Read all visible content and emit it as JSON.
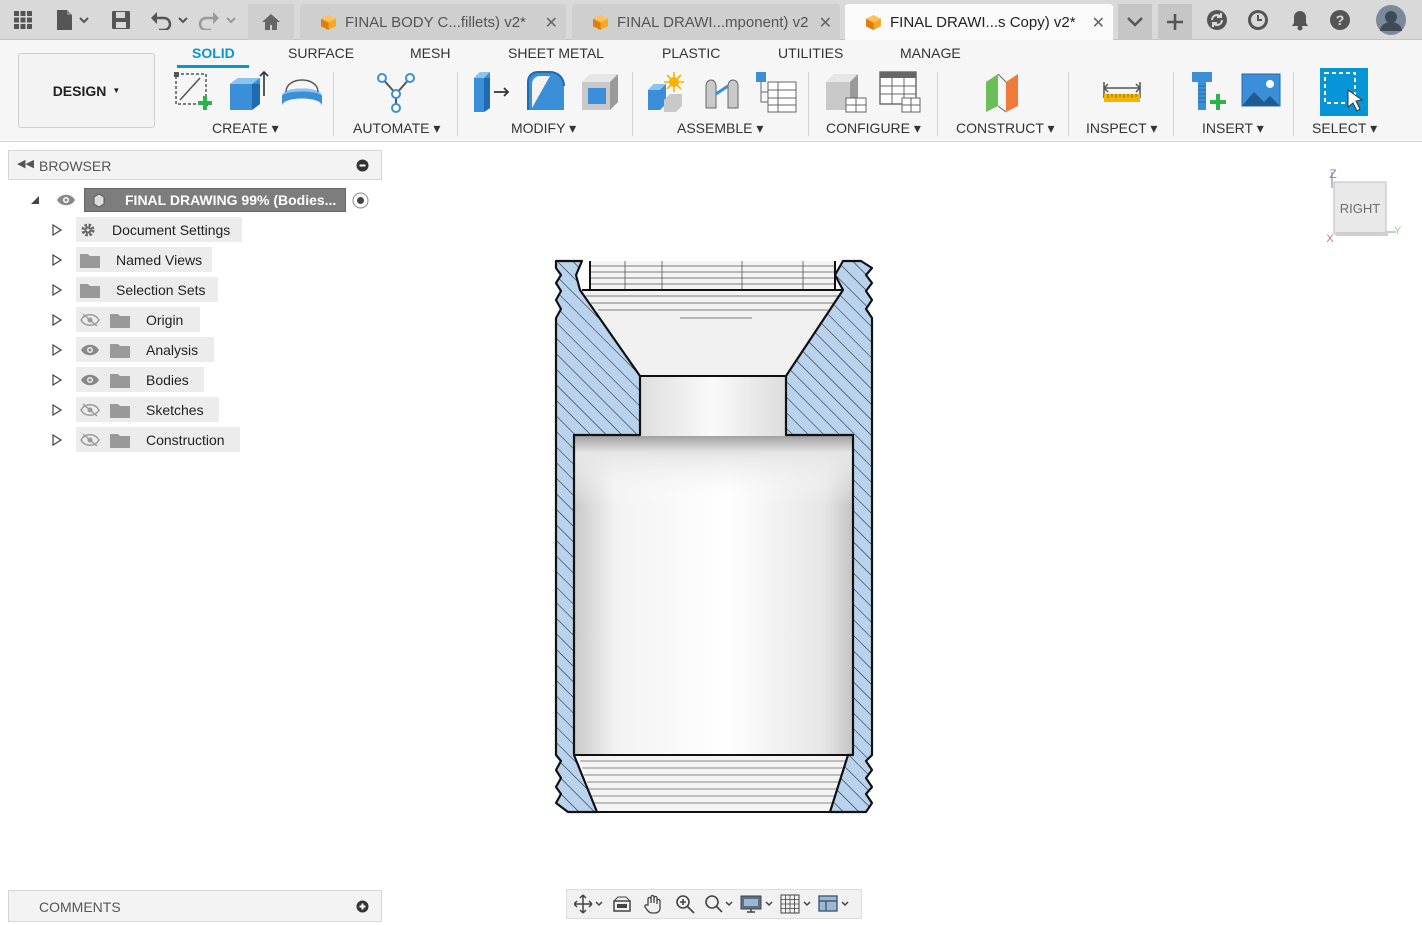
{
  "titlebar": {
    "tabs": [
      {
        "label": "FINAL BODY C...fillets) v2*",
        "active": false
      },
      {
        "label": "FINAL DRAWI...mponent) v2",
        "active": false
      },
      {
        "label": "FINAL DRAWI...s Copy) v2*",
        "active": true
      }
    ],
    "icons": [
      "apps-grid-icon",
      "file-icon",
      "save-icon",
      "undo-icon",
      "redo-icon",
      "home-icon",
      "tab-list-icon",
      "new-tab-icon",
      "sync-icon",
      "job-status-icon",
      "notifications-icon",
      "help-icon",
      "user-avatar"
    ]
  },
  "ribbon": {
    "workspace": "DESIGN",
    "tabs": [
      "SOLID",
      "SURFACE",
      "MESH",
      "SHEET METAL",
      "PLASTIC",
      "UTILITIES",
      "MANAGE"
    ],
    "active_tab": "SOLID",
    "groups": [
      {
        "label": "CREATE",
        "icons": [
          "create-sketch-icon",
          "extrude-icon",
          "revolve-icon"
        ]
      },
      {
        "label": "AUTOMATE",
        "icons": [
          "automate-icon"
        ]
      },
      {
        "label": "MODIFY",
        "icons": [
          "press-pull-icon",
          "fillet-icon",
          "shell-icon"
        ]
      },
      {
        "label": "ASSEMBLE",
        "icons": [
          "new-component-icon",
          "joint-icon",
          "assembly-table-icon"
        ]
      },
      {
        "label": "CONFIGURE",
        "icons": [
          "configure-icon",
          "configure-table-icon"
        ]
      },
      {
        "label": "CONSTRUCT",
        "icons": [
          "offset-plane-icon"
        ]
      },
      {
        "label": "INSPECT",
        "icons": [
          "measure-icon"
        ]
      },
      {
        "label": "INSERT",
        "icons": [
          "insert-mcmaster-icon",
          "insert-image-icon"
        ]
      },
      {
        "label": "SELECT",
        "icons": [
          "select-window-icon"
        ]
      }
    ]
  },
  "browser": {
    "title": "BROWSER",
    "root": "FINAL DRAWING 99% (Bodies...",
    "items": [
      {
        "label": "Document Settings",
        "icon": "gear-icon",
        "visibility": "none"
      },
      {
        "label": "Named Views",
        "icon": "folder-icon",
        "visibility": "none"
      },
      {
        "label": "Selection Sets",
        "icon": "folder-icon",
        "visibility": "none"
      },
      {
        "label": "Origin",
        "icon": "folder-icon",
        "visibility": "hidden"
      },
      {
        "label": "Analysis",
        "icon": "folder-icon",
        "visibility": "visible"
      },
      {
        "label": "Bodies",
        "icon": "folder-icon",
        "visibility": "visible"
      },
      {
        "label": "Sketches",
        "icon": "folder-icon",
        "visibility": "hidden"
      },
      {
        "label": "Construction",
        "icon": "folder-icon",
        "visibility": "hidden"
      }
    ]
  },
  "comments": {
    "title": "COMMENTS"
  },
  "viewcube": {
    "face": "RIGHT",
    "axes": [
      "Z",
      "Y",
      "X"
    ]
  },
  "navbar": {
    "icons": [
      "orbit-icon",
      "look-at-icon",
      "pan-icon",
      "zoom-icon",
      "fit-icon",
      "display-settings-icon",
      "grid-icon",
      "viewports-icon"
    ]
  },
  "colors": {
    "accent": "#0696d7",
    "section_fill": "#b9d3ef",
    "active_tab": "#fafafa"
  }
}
